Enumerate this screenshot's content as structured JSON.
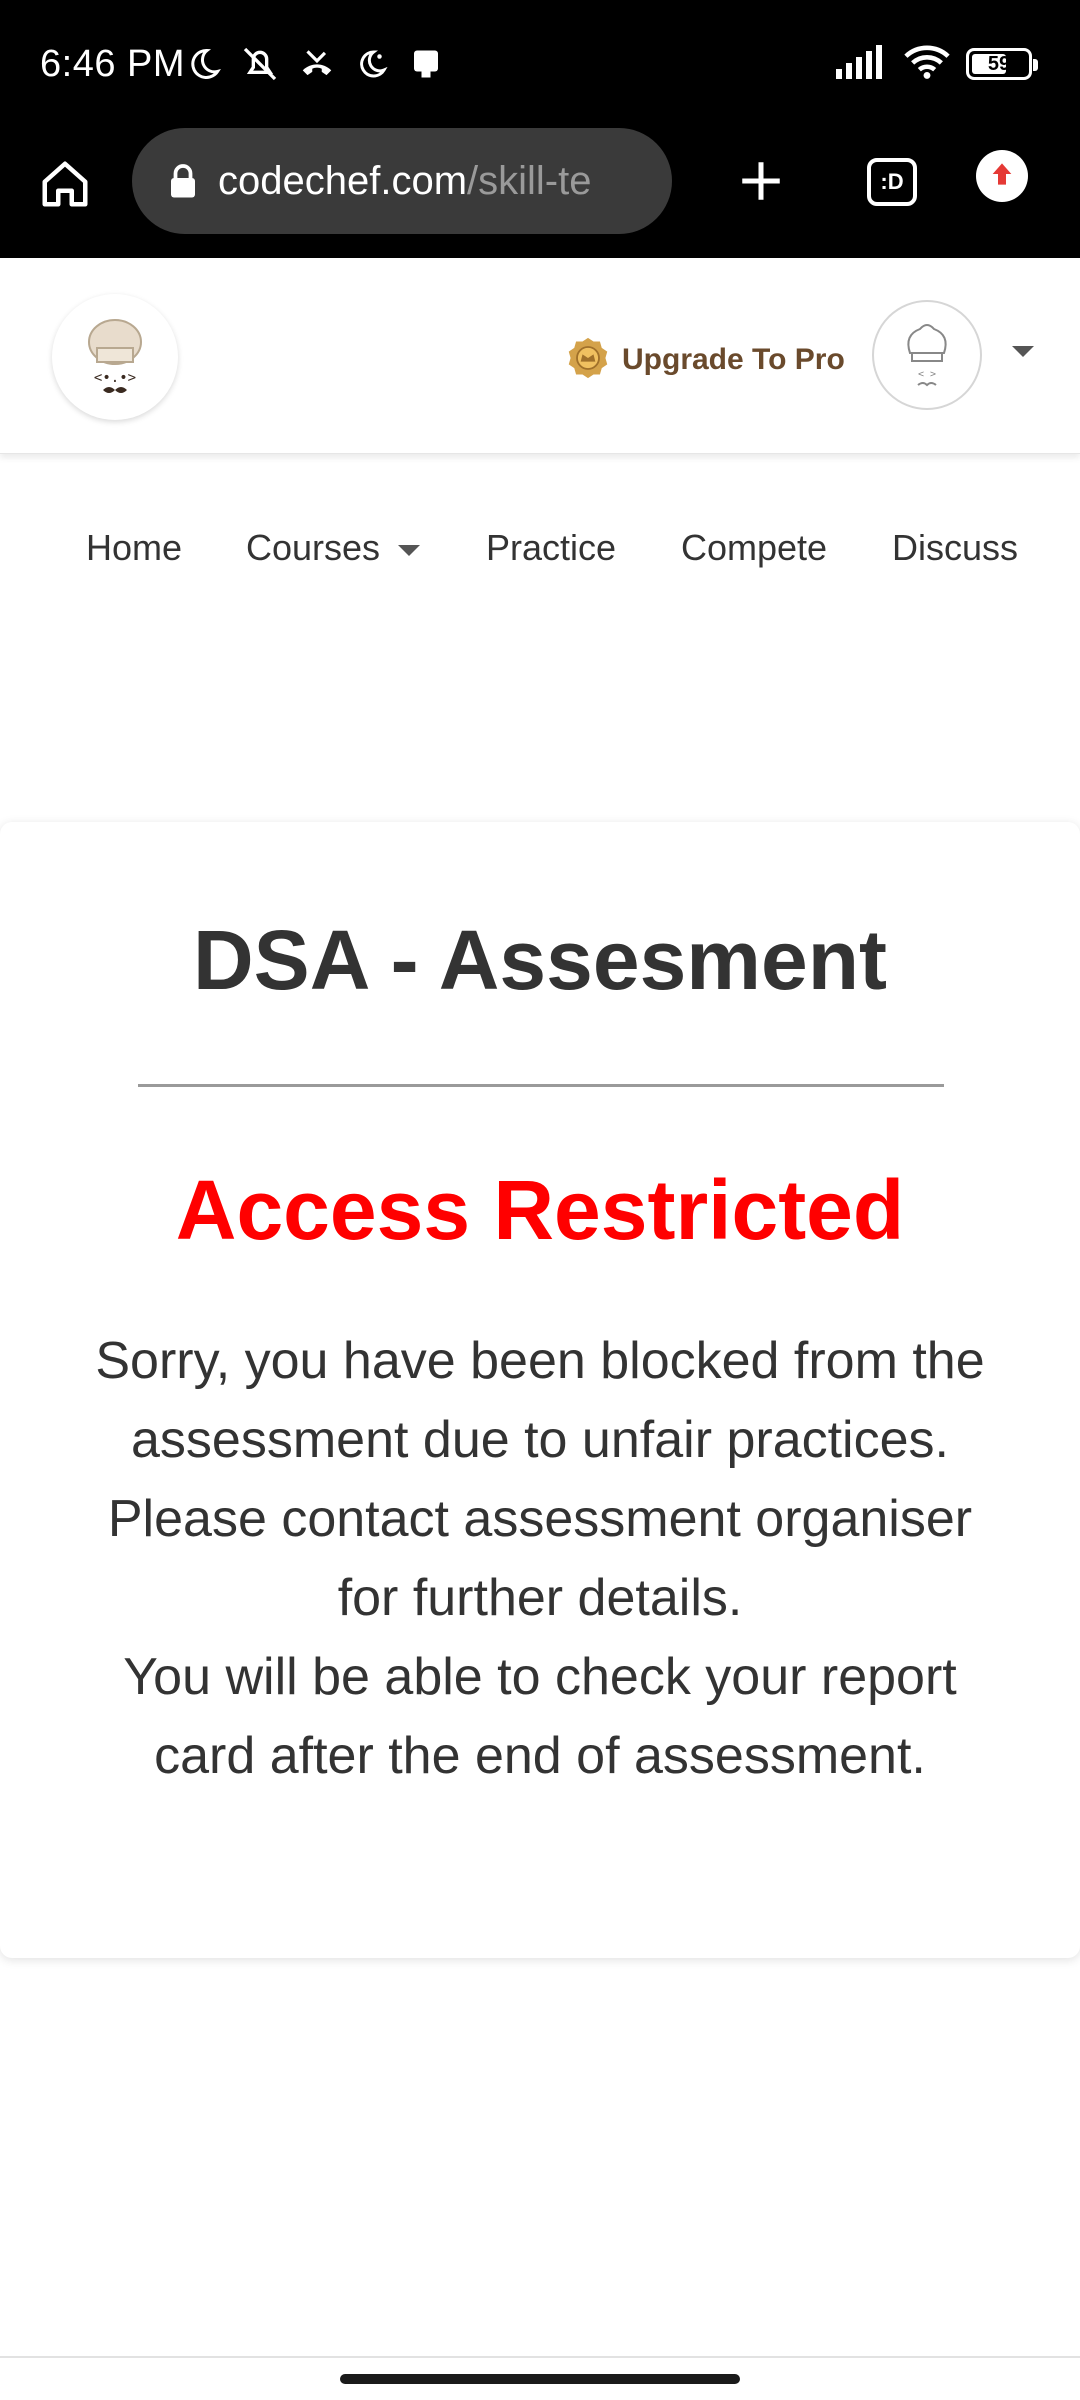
{
  "status_bar": {
    "time": "6:46 PM",
    "battery": "59",
    "icons": [
      "moon-icon",
      "mute-icon",
      "missed-call-icon",
      "night-mode-icon",
      "notification-icon",
      "signal-icon",
      "wifi-icon",
      "battery-icon"
    ]
  },
  "browser": {
    "url_domain": "codechef.com",
    "url_path": "/skill-te",
    "icons": [
      "home-icon",
      "lock-icon",
      "plus-icon",
      "tab-switcher-icon",
      "update-icon"
    ],
    "tabs_label": ":D"
  },
  "header": {
    "upgrade_label": "Upgrade To Pro",
    "icons": [
      "codechef-logo",
      "crown-badge-icon",
      "avatar",
      "caret-down-icon"
    ]
  },
  "nav": {
    "items": [
      {
        "label": "Home"
      },
      {
        "label": "Courses"
      },
      {
        "label": "Practice"
      },
      {
        "label": "Compete"
      },
      {
        "label": "Discuss"
      }
    ]
  },
  "card": {
    "title": "DSA - Assesment",
    "status": "Access Restricted",
    "message_lines": [
      "Sorry, you have been blocked from the assessment due to unfair practices.",
      "Please contact assessment organiser for further details.",
      "You will be able to check your report card after the end of assessment."
    ]
  },
  "colors": {
    "status_red": "#ff0000",
    "upgrade_brown": "#6a4a2c",
    "text_dark": "#333333"
  }
}
